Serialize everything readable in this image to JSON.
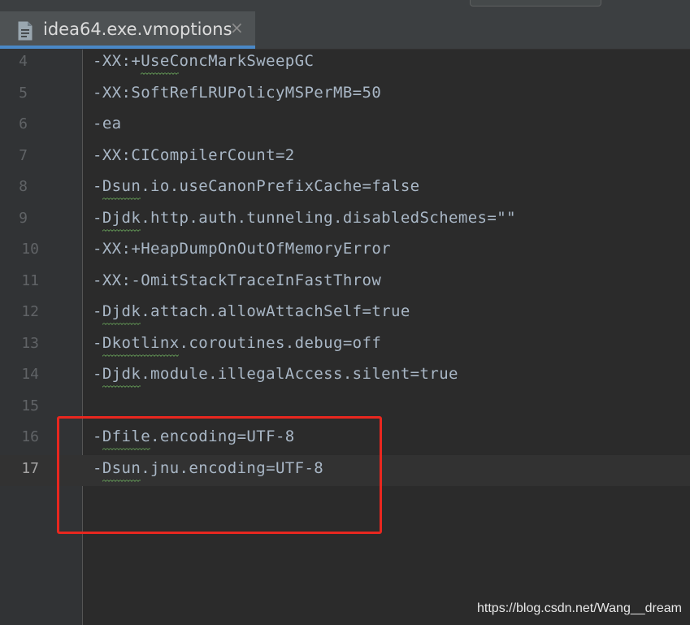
{
  "tab": {
    "title": "idea64.exe.vmoptions",
    "close_symbol": "×",
    "icon": "text-file-icon"
  },
  "lines": [
    {
      "number": "4",
      "text": "-XX:+UseConcMarkSweepGC"
    },
    {
      "number": "5",
      "text": "-XX:SoftRefLRUPolicyMSPerMB=50"
    },
    {
      "number": "6",
      "text": "-ea"
    },
    {
      "number": "7",
      "text": "-XX:CICompilerCount=2"
    },
    {
      "number": "8",
      "text": "-Dsun.io.useCanonPrefixCache=false"
    },
    {
      "number": "9",
      "text": "-Djdk.http.auth.tunneling.disabledSchemes=\"\""
    },
    {
      "number": "10",
      "text": "-XX:+HeapDumpOnOutOfMemoryError"
    },
    {
      "number": "11",
      "text": "-XX:-OmitStackTraceInFastThrow"
    },
    {
      "number": "12",
      "text": "-Djdk.attach.allowAttachSelf=true"
    },
    {
      "number": "13",
      "text": "-Dkotlinx.coroutines.debug=off"
    },
    {
      "number": "14",
      "text": "-Djdk.module.illegalAccess.silent=true"
    },
    {
      "number": "15",
      "text": ""
    },
    {
      "number": "16",
      "text": "-Dfile.encoding=UTF-8"
    },
    {
      "number": "17",
      "text": "-Dsun.jnu.encoding=UTF-8"
    }
  ],
  "current_line": "17",
  "watermark": "https://blog.csdn.net/Wang__dream",
  "colors": {
    "highlight_box": "#e8271f",
    "tab_underline": "#4a88c7",
    "code_text": "#a9b7c6",
    "squiggle": "#629755"
  }
}
